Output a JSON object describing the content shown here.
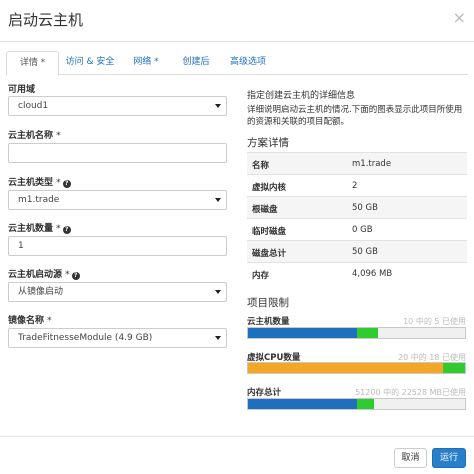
{
  "header": {
    "title": "启动云主机",
    "close": "×"
  },
  "tabs": [
    {
      "label": "详情 *"
    },
    {
      "label": "访问 & 安全"
    },
    {
      "label": "网络 *"
    },
    {
      "label": "创建后"
    },
    {
      "label": "高级选项"
    }
  ],
  "form": {
    "availability_zone": {
      "label": "可用域",
      "value": "cloud1"
    },
    "instance_name": {
      "label": "云主机名称",
      "required": "*",
      "value": ""
    },
    "flavor": {
      "label": "云主机类型",
      "required": "*",
      "value": "m1.trade"
    },
    "count": {
      "label": "云主机数量",
      "required": "*",
      "value": "1"
    },
    "boot_source": {
      "label": "云主机启动源",
      "required": "*",
      "value": "从镜像启动"
    },
    "image": {
      "label": "镜像名称",
      "required": "*",
      "value": "TradeFitnesseModule (4.9 GB)"
    }
  },
  "info": {
    "title": "指定创建云主机的详细信息",
    "description": "详细说明启动云主机的情况.下面的图表显示此项目所使用的资源和关联的项目配额。"
  },
  "flavor_details": {
    "title": "方案详情",
    "rows": [
      {
        "key": "名称",
        "value": "m1.trade"
      },
      {
        "key": "虚拟内核",
        "value": "2"
      },
      {
        "key": "根磁盘",
        "value": "50 GB"
      },
      {
        "key": "临时磁盘",
        "value": "0 GB"
      },
      {
        "key": "磁盘总计",
        "value": "50 GB"
      },
      {
        "key": "内存",
        "value": "4,096 MB"
      }
    ]
  },
  "limits": {
    "title": "项目限制",
    "items": [
      {
        "label": "云主机数量",
        "note": "10 中的 5 已使用",
        "used": 0.5,
        "added": 0.1,
        "used_color": "#1f6fbf",
        "added_color": "#2ecc2e"
      },
      {
        "label": "虚拟CPU数量",
        "note": "20 中的 18 已使用",
        "used": 0.9,
        "added": 0.1,
        "used_color": "#f5a623",
        "added_color": "#2ecc2e"
      },
      {
        "label": "内存总计",
        "note": "51200 中的 22528 MB已使用",
        "used": 0.5,
        "added": 0.08,
        "used_color": "#1f6fbf",
        "added_color": "#2ecc2e"
      }
    ]
  },
  "footer": {
    "cancel": "取消",
    "launch": "运行"
  }
}
